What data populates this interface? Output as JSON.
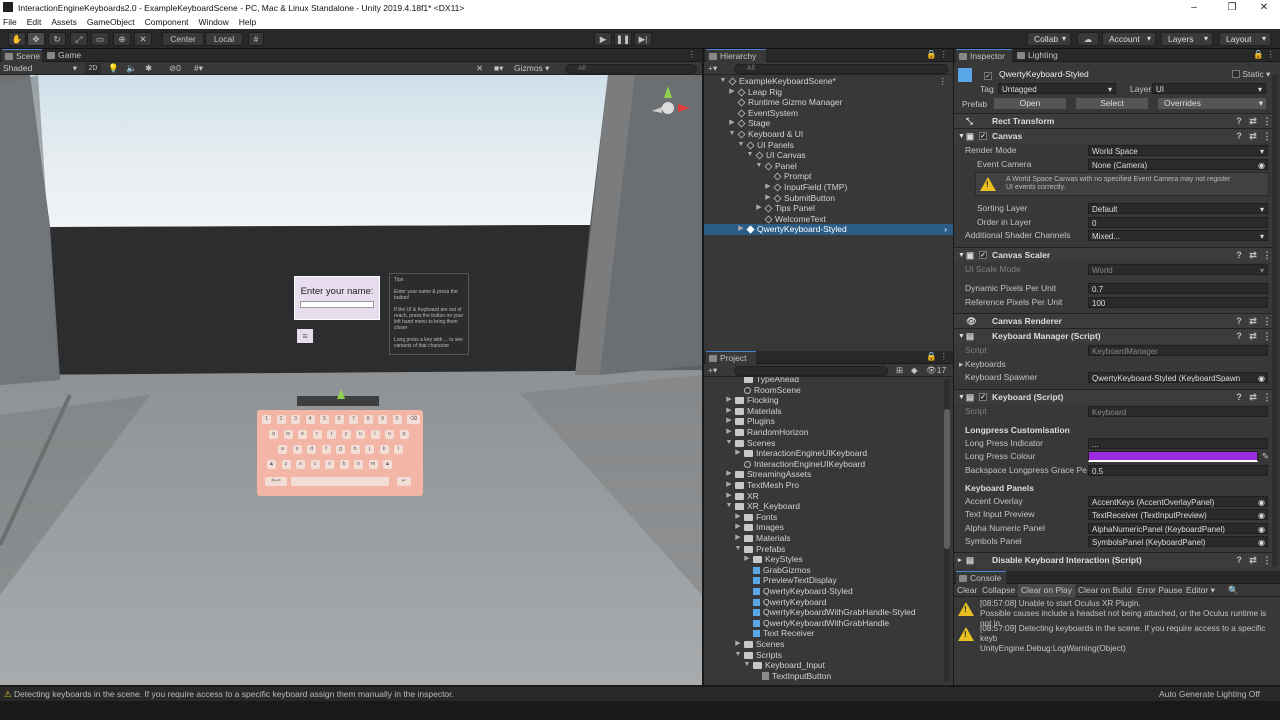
{
  "window": {
    "title": "InteractionEngineKeyboards2.0 - ExampleKeyboardScene - PC, Mac & Linux Standalone - Unity 2019.4.18f1* <DX11>"
  },
  "menu": [
    "File",
    "Edit",
    "Assets",
    "GameObject",
    "Component",
    "Window",
    "Help"
  ],
  "toolbar": {
    "pivot": "Center",
    "space": "Local",
    "collab": "Collab",
    "account": "Account",
    "layers": "Layers",
    "layout": "Layout"
  },
  "scene": {
    "tabs": [
      "Scene",
      "Game"
    ],
    "shading": "Shaded",
    "mode2d": "2D",
    "gizmos": "Gizmos",
    "search": "All",
    "audio_count": "0",
    "prompt_title": "Enter your name:",
    "tips_title": "Tips",
    "tips_lines": [
      "Enter your name & press the button!",
      "If the UI & Keyboard are out of reach, press the button on your left hand menu to bring them closer",
      "Long press a key with ... to see variants of that character"
    ],
    "keyboard_rows": [
      [
        "1",
        "2",
        "3",
        "4",
        "5",
        "6",
        "7",
        "8",
        "9",
        "0",
        "⌫"
      ],
      [
        "q",
        "w",
        "e",
        "r",
        "t",
        "y",
        "u",
        "i",
        "o",
        "p"
      ],
      [
        "a",
        "s",
        "d",
        "f",
        "g",
        "h",
        "j",
        "k",
        "l"
      ],
      [
        "▲",
        "z",
        "x",
        "c",
        "v",
        "b",
        "n",
        "m",
        "▲"
      ],
      [
        "#+=",
        "",
        "↵"
      ]
    ]
  },
  "hierarchy": {
    "title": "Hierarchy",
    "search": "All",
    "items": [
      {
        "label": "ExampleKeyboardScene*",
        "depth": 0,
        "expanded": true,
        "type": "scene"
      },
      {
        "label": "Leap Rig",
        "depth": 1,
        "expanded": false,
        "type": "go"
      },
      {
        "label": "Runtime Gizmo Manager",
        "depth": 1,
        "type": "go"
      },
      {
        "label": "EventSystem",
        "depth": 1,
        "type": "go"
      },
      {
        "label": "Stage",
        "depth": 1,
        "expanded": false,
        "type": "go"
      },
      {
        "label": "Keyboard & UI",
        "depth": 1,
        "expanded": true,
        "type": "go"
      },
      {
        "label": "UI Panels",
        "depth": 2,
        "expanded": true,
        "type": "go"
      },
      {
        "label": "UI Canvas",
        "depth": 3,
        "expanded": true,
        "type": "go"
      },
      {
        "label": "Panel",
        "depth": 4,
        "expanded": true,
        "type": "go"
      },
      {
        "label": "Prompt",
        "depth": 5,
        "type": "go"
      },
      {
        "label": "InputField (TMP)",
        "depth": 5,
        "expanded": false,
        "type": "go"
      },
      {
        "label": "SubmitButton",
        "depth": 5,
        "expanded": false,
        "type": "go"
      },
      {
        "label": "Tips Panel",
        "depth": 4,
        "expanded": false,
        "type": "go"
      },
      {
        "label": "WelcomeText",
        "depth": 4,
        "type": "go"
      },
      {
        "label": "QwertyKeyboard-Styled",
        "depth": 2,
        "expanded": false,
        "type": "prefab",
        "selected": true
      }
    ]
  },
  "project": {
    "title": "Project",
    "count": "17",
    "items": [
      {
        "label": "TypeAhead",
        "depth": 2,
        "type": "folder"
      },
      {
        "label": "RoomScene",
        "depth": 2,
        "type": "unity"
      },
      {
        "label": "Flocking",
        "depth": 1,
        "type": "folder",
        "expanded": false
      },
      {
        "label": "Materials",
        "depth": 1,
        "type": "folder",
        "expanded": false
      },
      {
        "label": "Plugins",
        "depth": 1,
        "type": "folder",
        "expanded": false
      },
      {
        "label": "RandomHorizon",
        "depth": 1,
        "type": "folder",
        "expanded": false
      },
      {
        "label": "Scenes",
        "depth": 1,
        "type": "folder",
        "expanded": true
      },
      {
        "label": "InteractionEngineUIKeyboard",
        "depth": 2,
        "type": "folder",
        "expanded": false
      },
      {
        "label": "InteractionEngineUIKeyboard",
        "depth": 2,
        "type": "unity"
      },
      {
        "label": "StreamingAssets",
        "depth": 1,
        "type": "folder",
        "expanded": false
      },
      {
        "label": "TextMesh Pro",
        "depth": 1,
        "type": "folder",
        "expanded": false
      },
      {
        "label": "XR",
        "depth": 1,
        "type": "folder",
        "expanded": false
      },
      {
        "label": "XR_Keyboard",
        "depth": 1,
        "type": "folder",
        "expanded": true
      },
      {
        "label": "Fonts",
        "depth": 2,
        "type": "folder",
        "expanded": false
      },
      {
        "label": "Images",
        "depth": 2,
        "type": "folder",
        "expanded": false
      },
      {
        "label": "Materials",
        "depth": 2,
        "type": "folder",
        "expanded": false
      },
      {
        "label": "Prefabs",
        "depth": 2,
        "type": "folder",
        "expanded": true
      },
      {
        "label": "KeyStyles",
        "depth": 3,
        "type": "folder",
        "expanded": false
      },
      {
        "label": "GrabGizmos",
        "depth": 3,
        "type": "prefab"
      },
      {
        "label": "PreviewTextDisplay",
        "depth": 3,
        "type": "prefab"
      },
      {
        "label": "QwertyKeyboard-Styled",
        "depth": 3,
        "type": "prefab"
      },
      {
        "label": "QwertyKeyboard",
        "depth": 3,
        "type": "prefab"
      },
      {
        "label": "QwertyKeyboardWithGrabHandle-Styled",
        "depth": 3,
        "type": "prefab"
      },
      {
        "label": "QwertyKeyboardWithGrabHandle",
        "depth": 3,
        "type": "prefab"
      },
      {
        "label": "Text Receiver",
        "depth": 3,
        "type": "prefab"
      },
      {
        "label": "Scenes",
        "depth": 2,
        "type": "folder",
        "expanded": false
      },
      {
        "label": "Scripts",
        "depth": 2,
        "type": "folder",
        "expanded": true
      },
      {
        "label": "Keyboard_Input",
        "depth": 3,
        "type": "folder",
        "expanded": true
      },
      {
        "label": "TextInputButton",
        "depth": 4,
        "type": "cs"
      }
    ]
  },
  "inspector": {
    "tabs": [
      "Inspector",
      "Lighting"
    ],
    "object_name": "QwertyKeyboard-Styled",
    "static_label": "Static",
    "tag_label": "Tag",
    "tag_value": "Untagged",
    "layer_label": "Layer",
    "layer_value": "UI",
    "prefab_label": "Prefab",
    "prefab_open": "Open",
    "prefab_select": "Select",
    "prefab_overrides": "Overrides",
    "rect_transform": "Rect Transform",
    "canvas": {
      "title": "Canvas",
      "render_mode_label": "Render Mode",
      "render_mode": "World Space",
      "event_camera_label": "Event Camera",
      "event_camera": "None (Camera)",
      "warning": "A World Space Canvas with no specified Event Camera may not register UI events correctly.",
      "sorting_layer_label": "Sorting Layer",
      "sorting_layer": "Default",
      "order_label": "Order in Layer",
      "order": "0",
      "shader_label": "Additional Shader Channels",
      "shader": "Mixed..."
    },
    "canvas_scaler": {
      "title": "Canvas Scaler",
      "scale_mode_label": "UI Scale Mode",
      "scale_mode": "World",
      "dpu_label": "Dynamic Pixels Per Unit",
      "dpu": "0.7",
      "rppu_label": "Reference Pixels Per Unit",
      "rppu": "100"
    },
    "canvas_renderer": {
      "title": "Canvas Renderer"
    },
    "keyboard_manager": {
      "title": "Keyboard Manager (Script)",
      "script_label": "Script",
      "script": "KeyboardManager",
      "keyboards_label": "Keyboards",
      "spawner_label": "Keyboard Spawner",
      "spawner": "QwertyKeyboard-Styled (KeyboardSpawn"
    },
    "keyboard": {
      "title": "Keyboard (Script)",
      "script_label": "Script",
      "script": "Keyboard",
      "longpress_header": "Longpress Customisation",
      "indicator_label": "Long Press Indicator",
      "indicator": "...",
      "colour_label": "Long Press Colour",
      "colour": "#9b2de0",
      "grace_label": "Backspace Longpress Grace Pe",
      "grace": "0.5",
      "panels_header": "Keyboard Panels",
      "accent_label": "Accent Overlay",
      "accent": "AccentKeys (AccentOverlayPanel)",
      "preview_label": "Text Input Preview",
      "preview": "TextReceiver (TextInputPreview)",
      "alpha_label": "Alpha Numeric Panel",
      "alpha": "AlphaNumericPanel (KeyboardPanel)",
      "symbols_label": "Symbols Panel",
      "symbols": "SymbolsPanel (KeyboardPanel)"
    },
    "disable_interaction": {
      "title": "Disable Keyboard Interaction (Script)"
    }
  },
  "console": {
    "title": "Console",
    "buttons": [
      "Clear",
      "Collapse",
      "Clear on Play",
      "Clear on Build",
      "Error Pause",
      "Editor"
    ],
    "entries": [
      {
        "line1": "[08:57:08] Unable to start Oculus XR Plugin.",
        "line2": "Possible causes include a headset not being attached, or the Oculus runtime is not in"
      },
      {
        "line1": "[08:57:09] Detecting keyboards in the scene. If you require access to a specific keyb",
        "line2": "UnityEngine.Debug:LogWarning(Object)"
      }
    ]
  },
  "status": {
    "message": "Detecting keyboards in the scene. If you require access to a specific keyboard assign them manually in the inspector.",
    "right": "Auto Generate Lighting Off"
  },
  "colors": {
    "accent": "#4a82d8",
    "selection": "#2c5d87",
    "warning": "#e8c020",
    "prefab": "#5aa7e8"
  }
}
